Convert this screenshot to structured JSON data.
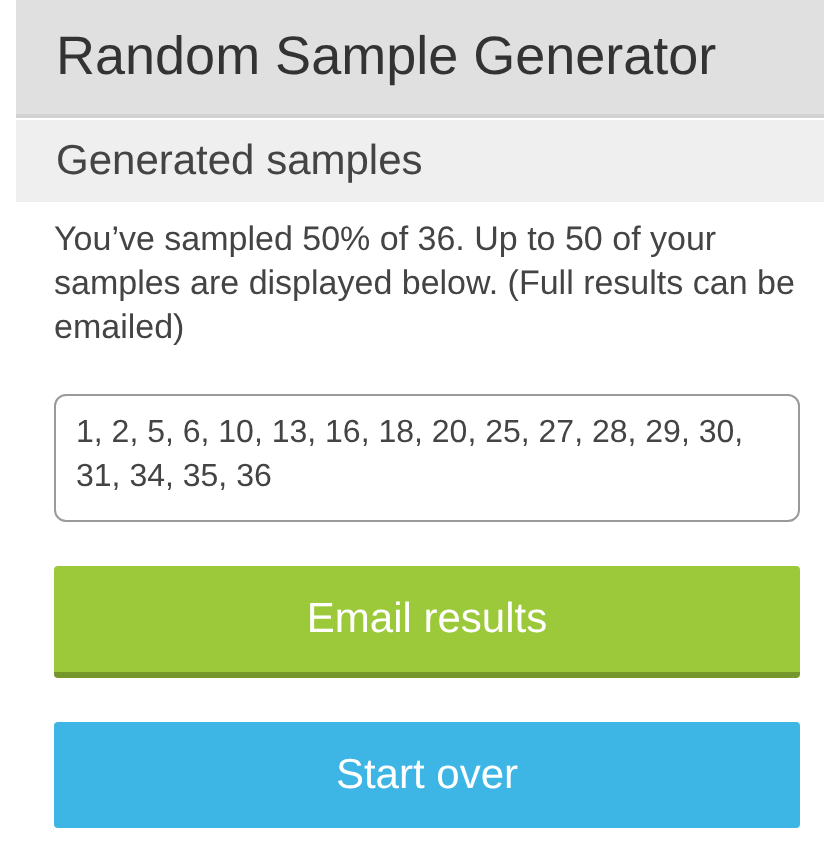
{
  "app_bar": {
    "title": "Random Sample Generator"
  },
  "section": {
    "title": "Generated samples"
  },
  "description": "You’ve sampled 50% of 36. Up to 50 of your samples are displayed below. (Full results can be emailed)",
  "results": {
    "value": "1, 2, 5, 6, 10, 13, 16, 18, 20, 25, 27, 28, 29, 30, 31, 34, 35, 36"
  },
  "buttons": [
    {
      "label": "Email results",
      "color": "#9bc93a"
    },
    {
      "label": "Start over",
      "color": "#3eb6e5"
    }
  ]
}
